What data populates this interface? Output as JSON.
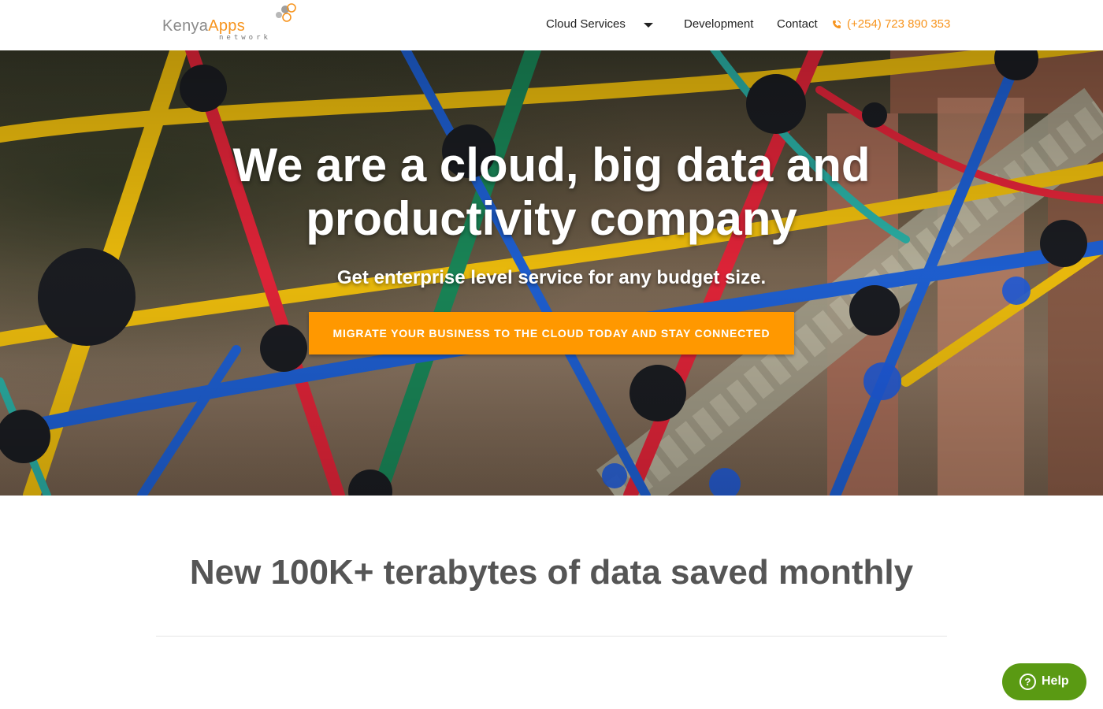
{
  "brand": {
    "name_part1": "Kenya",
    "name_part2": "Apps",
    "subtitle": "network",
    "color_primary": "#f7941d",
    "color_grey": "#8a8a8a"
  },
  "nav": {
    "items": [
      {
        "label": "Cloud Services",
        "has_dropdown": true
      },
      {
        "label": "Development"
      },
      {
        "label": "Contact"
      }
    ],
    "phone_icon": "phone-icon",
    "phone": "(+254) 723 890 353"
  },
  "hero": {
    "title": "We are a cloud, big data and productivity company",
    "subtitle": "Get enterprise level service for any budget size.",
    "cta_label": "MIGRATE YOUR BUSINESS TO THE CLOUD TODAY AND STAY CONNECTED",
    "cta_color": "#ff9800",
    "background": "photo of colorful rope climbing net on a playground"
  },
  "stats": {
    "heading": "New 100K+ terabytes of data saved monthly"
  },
  "help": {
    "icon": "question-circle-icon",
    "label": "Help",
    "color": "#5a9a13"
  }
}
